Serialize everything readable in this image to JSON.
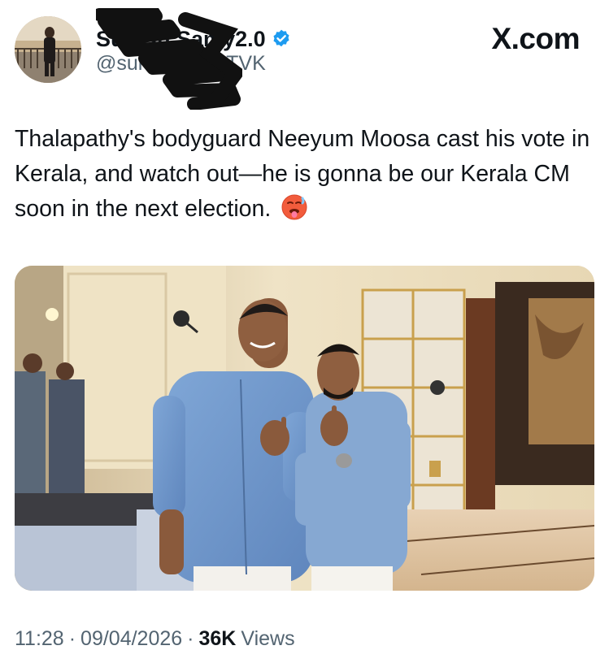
{
  "post": {
    "display_name": "Suresh Samy2.0",
    "handle": "@sureshsamyTVK",
    "brand": "X.com",
    "text": "Thalapathy's bodyguard Neeyum Moosa cast his vote in Kerala, and watch out—he is gonna be our Kerala CM soon in the next election.",
    "emoji": "hot-face-emoji",
    "time": "11:28",
    "dot1": "·",
    "date": "09/04/2026",
    "dot2": "·",
    "views_count": "36K",
    "views_label": "Views"
  },
  "colors": {
    "text_primary": "#0f1419",
    "text_secondary": "#536471",
    "verified_blue": "#1d9bf0",
    "redaction": "#111111"
  }
}
